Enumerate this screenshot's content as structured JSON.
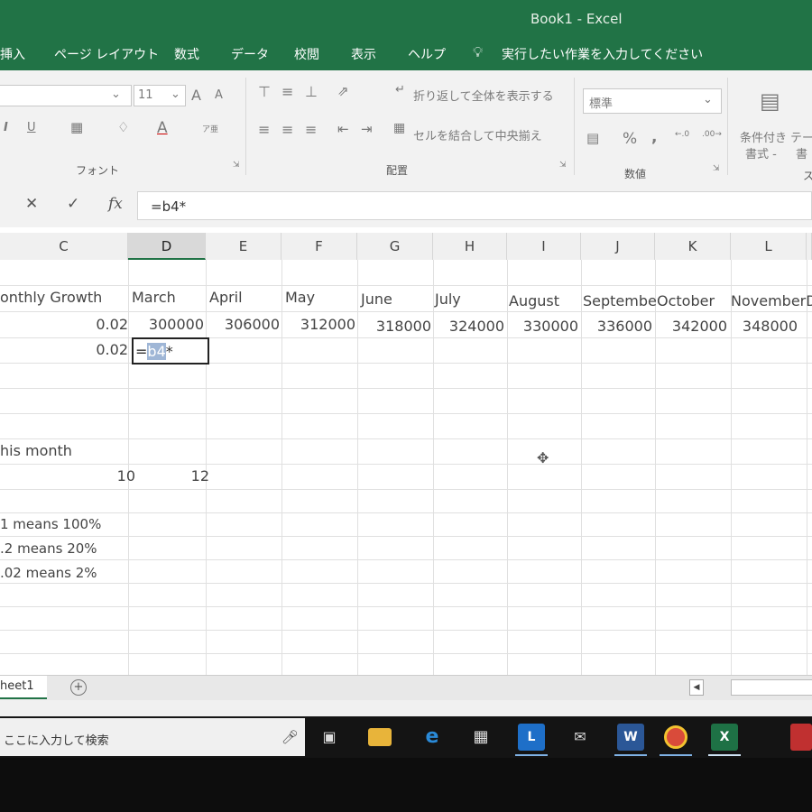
{
  "window": {
    "title": "Book1  -  Excel"
  },
  "menu": {
    "items": [
      "挿入",
      "ページ レイアウト",
      "数式",
      "データ",
      "校閲",
      "表示",
      "ヘルプ"
    ],
    "tell_me": "実行したい作業を入力してください"
  },
  "ribbon": {
    "font_size": "11",
    "grow_font": "A",
    "shrink_font": "A",
    "italic": "I",
    "underline": "U",
    "font_color": "A",
    "phonetic": "ア亜",
    "wrap_text": "折り返して全体を表示する",
    "merge_center": "セルを結合して中央揃え",
    "number_format": "標準",
    "percent": "%",
    "comma": ",",
    "conditional_format": "条件付き",
    "conditional_format_sub": "書式 -",
    "table_format": "テー",
    "table_format_sub": "書",
    "groups": {
      "font": "フォント",
      "alignment": "配置",
      "number": "数値",
      "styles": "ス"
    }
  },
  "formula_bar": {
    "cancel": "✕",
    "enter": "✓",
    "fx": "fx",
    "value": "=b4*"
  },
  "columns": [
    "C",
    "D",
    "E",
    "F",
    "G",
    "H",
    "I",
    "J",
    "K",
    "L"
  ],
  "selected_column": "D",
  "cells": {
    "row_header_text": "onthly Growth",
    "months": [
      "March",
      "April",
      "May",
      "June",
      "July",
      "August",
      "Septembe",
      "October",
      "NovemberD"
    ],
    "growth_1": "0.02",
    "values": [
      "300000",
      "306000",
      "312000",
      "318000",
      "324000",
      "330000",
      "336000",
      "342000",
      "348000"
    ],
    "growth_2": "0.02",
    "editing_prefix": "=",
    "editing_ref": "b4",
    "editing_suffix": "*",
    "this_month_label": "his month",
    "val_10": "10",
    "val_12": "12",
    "note_1": "1 means 100%",
    "note_2": ".2 means 20%",
    "note_3": ".02 means 2%"
  },
  "sheet": {
    "tab": "heet1",
    "add": "+"
  },
  "taskbar": {
    "search_placeholder": "ここに入力して検索",
    "apps": [
      "task-view",
      "file-explorer",
      "edge",
      "store",
      "lync",
      "mail",
      "word",
      "chrome",
      "excel"
    ],
    "app_letters": {
      "lync": "L",
      "word": "W",
      "excel": "X"
    }
  },
  "colors": {
    "excel_green": "#217346",
    "taskbar": "#141414"
  }
}
